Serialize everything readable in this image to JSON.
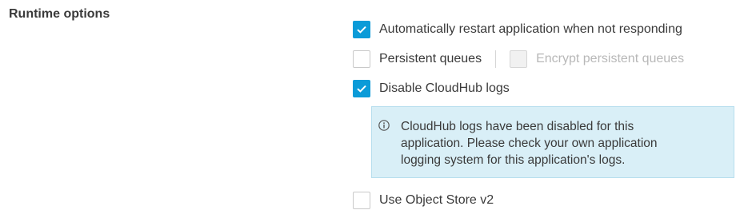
{
  "section": {
    "title": "Runtime options"
  },
  "options": {
    "auto_restart": {
      "label": "Automatically restart application when not responding",
      "checked": true
    },
    "persistent_queues": {
      "label": "Persistent queues",
      "checked": false
    },
    "encrypt_persistent_queues": {
      "label": "Encrypt persistent queues",
      "checked": false,
      "disabled": true
    },
    "disable_cloudhub_logs": {
      "label": "Disable CloudHub logs",
      "checked": true
    },
    "object_store_v2": {
      "label": "Use Object Store v2",
      "checked": false
    }
  },
  "info": {
    "icon": "info-circle-icon",
    "message": "CloudHub logs have been disabled for this application. Please check your own application logging system for this application's logs."
  },
  "colors": {
    "accent": "#0b9bd8",
    "info_background": "#d9eff7",
    "info_border": "#b7deee",
    "text": "#3a3a3a",
    "disabled_text": "#b8b8b8"
  }
}
